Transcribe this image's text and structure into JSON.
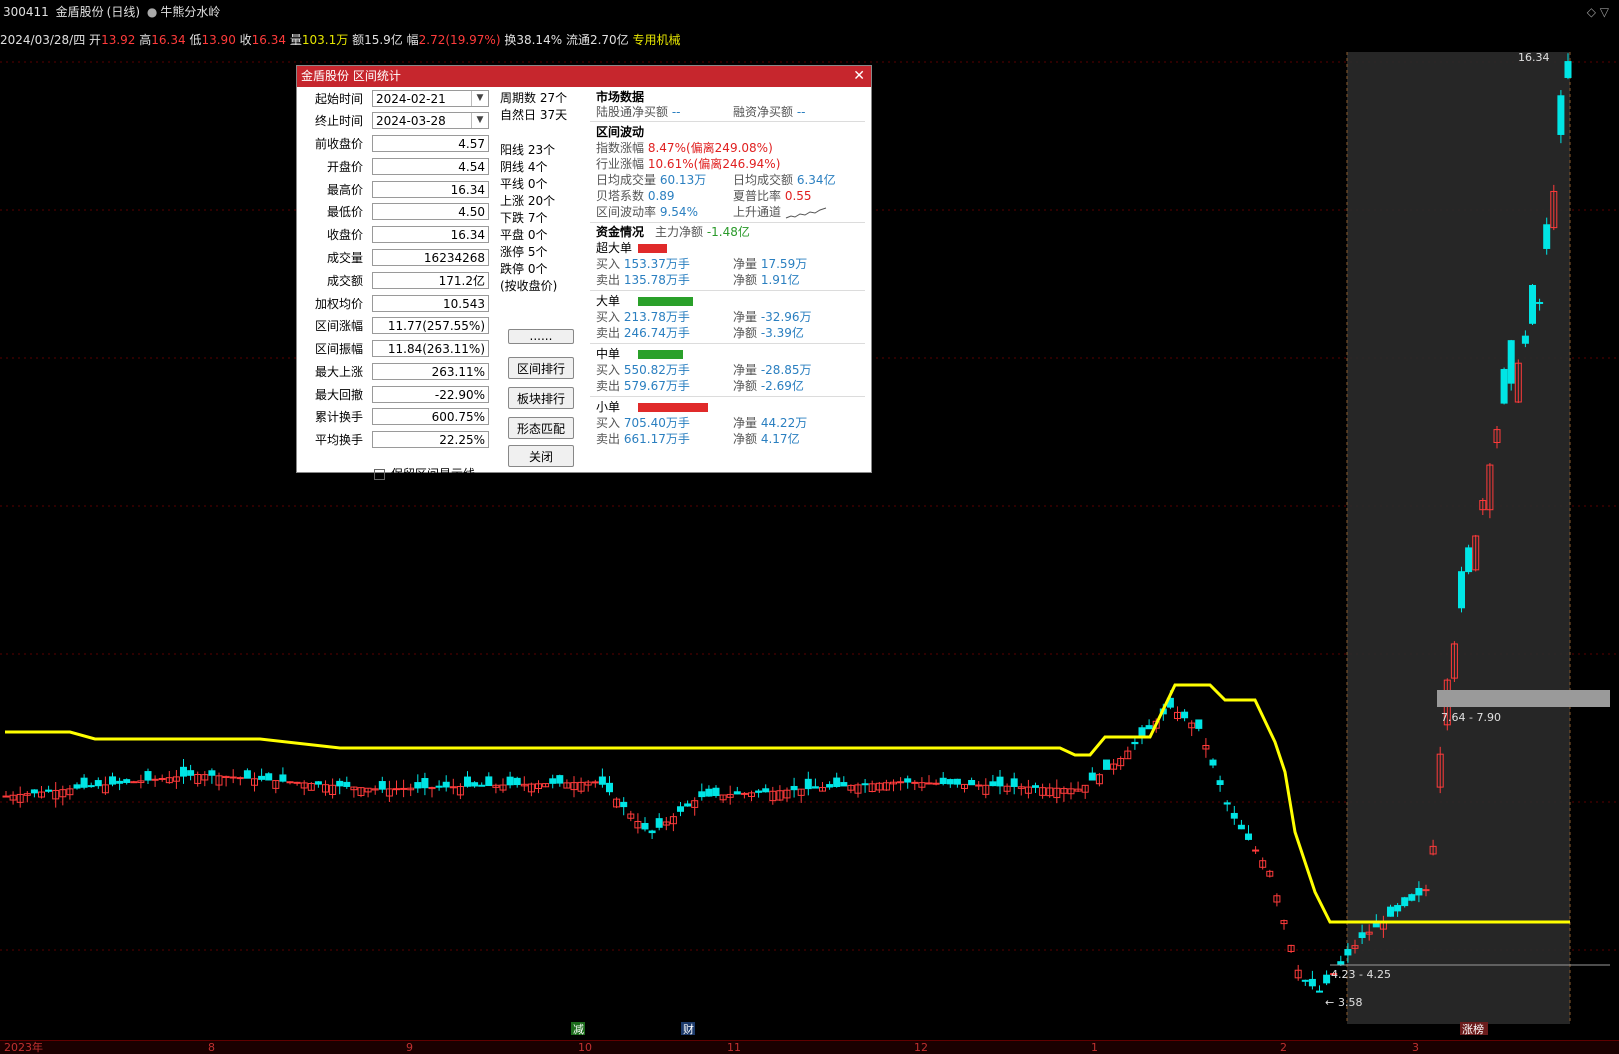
{
  "header": {
    "code": "300411",
    "name": "金盾股份",
    "period": "(日线)",
    "indicator": "牛熊分水岭",
    "win_icons": "◇ ▽"
  },
  "quote": {
    "date": "2024/03/28/四",
    "open_label": "开",
    "open": "13.92",
    "high_label": "高",
    "high": "16.34",
    "low_label": "低",
    "low": "13.90",
    "close_label": "收",
    "close": "16.34",
    "vol_label": "量",
    "vol": "103.1万",
    "amt_label": "额",
    "amt": "15.9亿",
    "chg_label": "幅",
    "chg": "2.72(19.97%)",
    "turn_label": "换",
    "turn": "38.14%",
    "float_label": "流通",
    "float": "2.70亿",
    "sector": "专用机械"
  },
  "chart_labels": {
    "high_mark": "16.34",
    "low_mark": "3.58",
    "band1": "7.64 - 7.90",
    "band2": "4.23 - 4.25",
    "event1": "减",
    "event2": "财",
    "event3": "涨榜"
  },
  "xaxis": [
    "2023年",
    "8",
    "9",
    "10",
    "11",
    "12",
    "1",
    "2",
    "3"
  ],
  "dialog": {
    "title": "金盾股份 区间统计",
    "fields": [
      {
        "label": "起始时间",
        "value": "2024-02-21"
      },
      {
        "label": "终止时间",
        "value": "2024-03-28"
      },
      {
        "label": "前收盘价",
        "value": "4.57"
      },
      {
        "label": "开盘价",
        "value": "4.54"
      },
      {
        "label": "最高价",
        "value": "16.34"
      },
      {
        "label": "最低价",
        "value": "4.50"
      },
      {
        "label": "收盘价",
        "value": "16.34"
      },
      {
        "label": "成交量",
        "value": "16234268"
      },
      {
        "label": "成交额",
        "value": "171.2亿"
      },
      {
        "label": "加权均价",
        "value": "10.543"
      },
      {
        "label": "区间涨幅",
        "value": "11.77(257.55%)"
      },
      {
        "label": "区间振幅",
        "value": "11.84(263.11%)"
      },
      {
        "label": "最大上涨",
        "value": "263.11%"
      },
      {
        "label": "最大回撤",
        "value": "-22.90%"
      },
      {
        "label": "累计换手",
        "value": "600.75%"
      },
      {
        "label": "平均换手",
        "value": "22.25%"
      }
    ],
    "counts_top": [
      "周期数 27个",
      "自然日 37天"
    ],
    "counts": [
      "阳线 23个",
      "阴线 4个",
      "平线 0个",
      "上涨 20个",
      "下跌 7个",
      "平盘 0个",
      "涨停 5个",
      "跌停 0个",
      "(按收盘价)"
    ],
    "buttons": [
      "......",
      "区间排行",
      "板块排行",
      "形态匹配",
      "关闭"
    ],
    "keep_line": "保留区间显示线",
    "market": {
      "title": "市场数据",
      "hgt_label": "陆股通净买额",
      "hgt": "--",
      "rz_label": "融资净买额",
      "rz": "--"
    },
    "volatility": {
      "title": "区间波动",
      "idx_label": "指数涨幅",
      "idx": "8.47%",
      "idx_dev_label": "偏离",
      "idx_dev": "249.08%",
      "ind_label": "行业涨幅",
      "ind": "10.61%",
      "ind_dev_label": "偏离",
      "ind_dev": "246.94%",
      "avgvol_label": "日均成交量",
      "avgvol": "60.13万",
      "avgamt_label": "日均成交额",
      "avgamt": "6.34亿",
      "beta_label": "贝塔系数",
      "beta": "0.89",
      "sharpe_label": "夏普比率",
      "sharpe": "0.55",
      "vola_label": "区间波动率",
      "vola": "9.54%",
      "trend": "上升通道"
    },
    "funds": {
      "title": "资金情况",
      "main_label": "主力净额",
      "main": "-1.48亿",
      "groups": [
        {
          "name": "超大单",
          "color": "#e02a2a",
          "bar": 0.42,
          "buy": "153.37万手",
          "sell": "135.78万手",
          "net": "17.59万",
          "netamt": "1.91亿",
          "netcolor": "bl"
        },
        {
          "name": "大单",
          "color": "#2aa02a",
          "bar": 0.79,
          "buy": "213.78万手",
          "sell": "246.74万手",
          "net": "-32.96万",
          "netamt": "-3.39亿",
          "netcolor": "bl"
        },
        {
          "name": "中单",
          "color": "#2aa02a",
          "bar": 0.64,
          "buy": "550.82万手",
          "sell": "579.67万手",
          "net": "-28.85万",
          "netamt": "-2.69亿",
          "netcolor": "bl"
        },
        {
          "name": "小单",
          "color": "#e02a2a",
          "bar": 1.0,
          "buy": "705.40万手",
          "sell": "661.17万手",
          "net": "44.22万",
          "netamt": "4.17亿",
          "netcolor": "bl"
        }
      ],
      "buy_label": "买入",
      "sell_label": "卖出",
      "net_label": "净量",
      "netamt_label": "净额"
    }
  }
}
